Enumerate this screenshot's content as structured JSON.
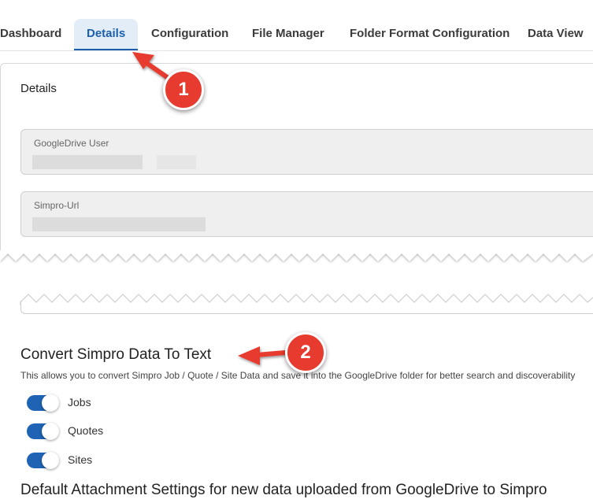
{
  "tabs": [
    {
      "label": "Dashboard"
    },
    {
      "label": "Details"
    },
    {
      "label": "Configuration"
    },
    {
      "label": "File Manager"
    },
    {
      "label": "Folder Format Configuration"
    },
    {
      "label": "Data View"
    }
  ],
  "details": {
    "title": "Details",
    "fields": [
      {
        "label": "GoogleDrive User"
      },
      {
        "label": "Simpro-Url"
      }
    ]
  },
  "convert": {
    "title": "Convert Simpro Data To Text",
    "description": "This allows you to convert Simpro Job / Quote / Site Data and save it into the GoogleDrive folder for better search and discoverability",
    "toggles": [
      {
        "label": "Jobs",
        "on": true
      },
      {
        "label": "Quotes",
        "on": true
      },
      {
        "label": "Sites",
        "on": true
      }
    ]
  },
  "attachments": {
    "title": "Default Attachment Settings for new data uploaded from GoogleDrive to Simpro"
  },
  "callouts": [
    {
      "number": "1"
    },
    {
      "number": "2"
    }
  ],
  "colors": {
    "accent": "#1b5fad",
    "toggle_on": "#1e63b4",
    "callout": "#e63b2e"
  }
}
